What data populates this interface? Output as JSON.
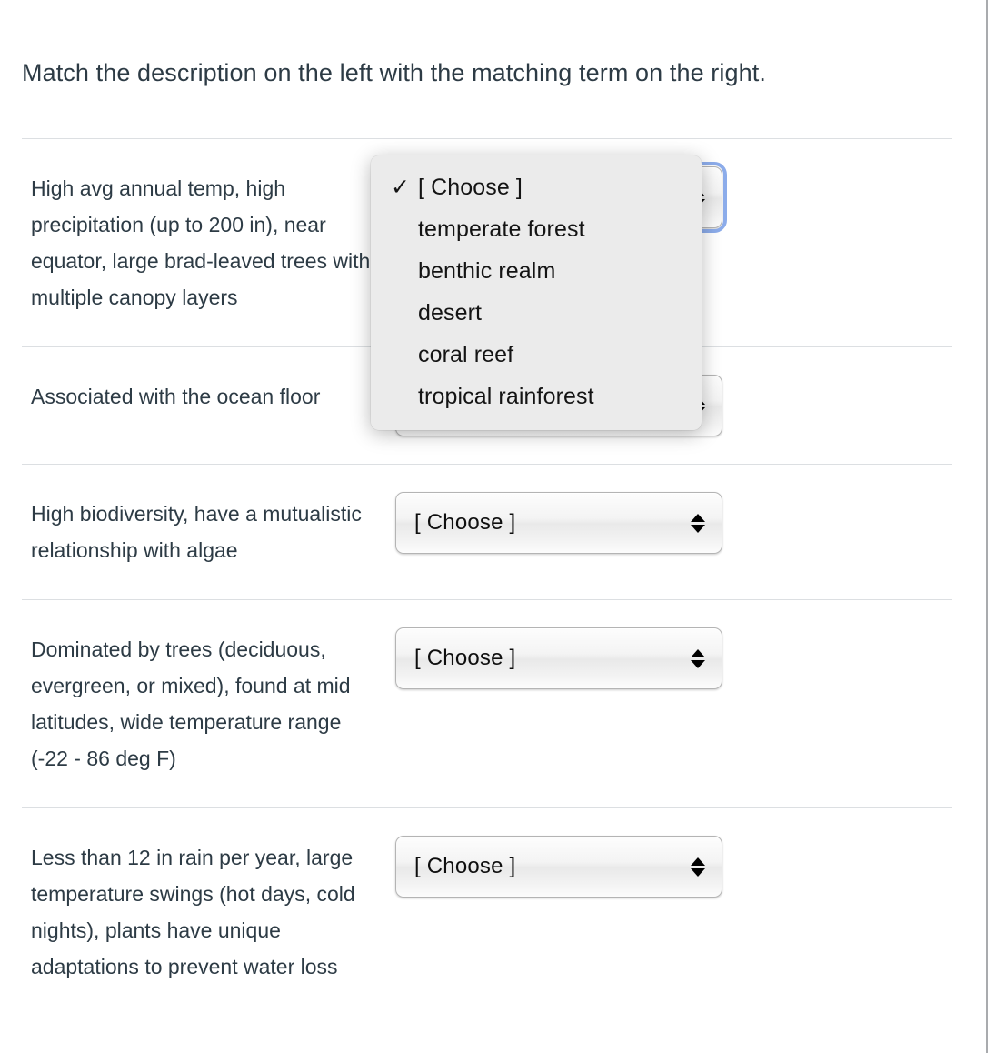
{
  "question": {
    "prompt": "Match the description on the left with the matching term on the right."
  },
  "rows": [
    {
      "description": "High avg annual temp, high precipitation (up to 200 in), near equator, large brad-leaved trees with multiple canopy layers",
      "select_value": "[ Choose ]",
      "focused": true
    },
    {
      "description": "Associated with the ocean floor",
      "select_value": "[ Choose ]",
      "focused": false
    },
    {
      "description": "High biodiversity, have a mutualistic relationship with algae",
      "select_value": "[ Choose ]",
      "focused": false
    },
    {
      "description": "Dominated by trees (deciduous, evergreen, or mixed), found at mid latitudes, wide temperature range (-22 - 86 deg F)",
      "select_value": "[ Choose ]",
      "focused": false
    },
    {
      "description": "Less than 12 in rain per year, large temperature swings (hot days, cold nights), plants have unique adaptations to prevent water loss",
      "select_value": "[ Choose ]",
      "focused": false
    }
  ],
  "dropdown": {
    "open": true,
    "selected_index": 0,
    "checkmark": "✓",
    "options": [
      "[ Choose ]",
      "temperate forest",
      "benthic realm",
      "desert",
      "coral reef",
      "tropical rainforest"
    ]
  },
  "colors": {
    "focus_ring": "#8cacea",
    "divider": "#dcdfe2",
    "text": "#2d3b45",
    "dropdown_bg": "#ebebeb",
    "page_edge": "#a9abae"
  }
}
